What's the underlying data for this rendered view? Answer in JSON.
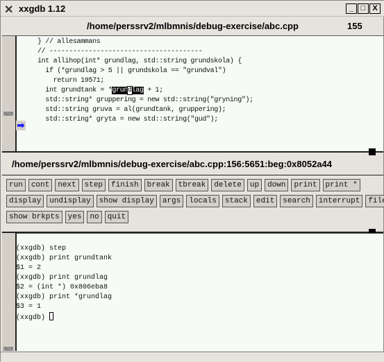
{
  "window": {
    "title": "xxgdb 1.12",
    "controls": [
      "_",
      "□",
      "X"
    ]
  },
  "source": {
    "filename": "/home/perssrv2/mlbmnis/debug-exercise/abc.cpp",
    "line_number": "155",
    "lines": [
      "} // allesammans",
      "",
      "// ---------------------------------------",
      "",
      "int allihop(int* grundlag, std::string grundskola) {",
      "  if (*grundlag > 5 || grundskola == \"grundval\")",
      "    return 19571;",
      "  int grundtank = *",
      "  std::string* gruppering = new std::string(\"gryning\");",
      "  std::string gruva = al(grundtank, gruppering);",
      "  std::string* gryta = new std::string(\"gud\");"
    ],
    "selected_line_tail": " + 1;",
    "selection": {
      "before": "grun",
      "cursor": "d",
      "after": "lag"
    },
    "execution_arrow_line": "std::string gruva = al(grundtank, gruppering);",
    "arrow_color": "#1a1aff"
  },
  "status": "/home/perssrv2/mlbmnis/debug-exercise/abc.cpp:156:5651:beg:0x8052a44",
  "buttons": [
    [
      "run",
      "cont",
      "next",
      "step",
      "finish",
      "break",
      "tbreak",
      "delete",
      "up",
      "down",
      "print",
      "print *"
    ],
    [
      "display",
      "undisplay",
      "show display",
      "args",
      "locals",
      "stack",
      "edit",
      "search",
      "interrupt",
      "file"
    ],
    [
      "show brkpts",
      "yes",
      "no",
      "quit"
    ]
  ],
  "console": {
    "lines": [
      "(xxgdb) step",
      "(xxgdb) print grundtank",
      "$1 = 2",
      "(xxgdb) print grundlag",
      "$2 = (int *) 0x806eba8",
      "(xxgdb) print *grundlag",
      "$3 = 1"
    ],
    "prompt": "(xxgdb) "
  }
}
